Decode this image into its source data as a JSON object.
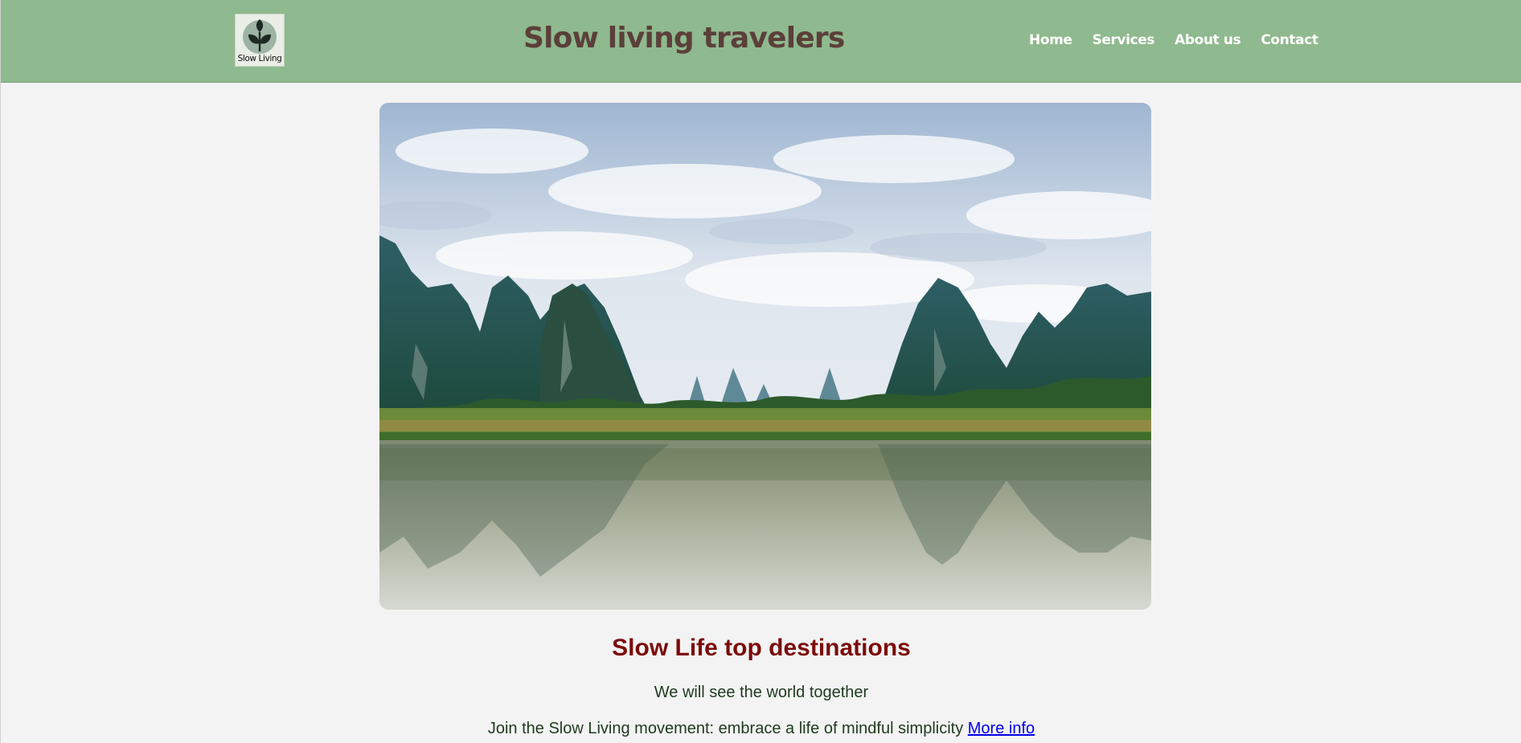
{
  "header": {
    "logo_text": "Slow Living",
    "title": "Slow living travelers",
    "nav": [
      {
        "label": "Home"
      },
      {
        "label": "Services"
      },
      {
        "label": "About us"
      },
      {
        "label": "Contact"
      }
    ]
  },
  "hero": {
    "image": "mountain-river-landscape"
  },
  "main": {
    "headline": "Slow Life top destinations",
    "subtitle": "We will see the world together",
    "tagline": "Join the Slow Living movement: embrace a life of mindful simplicity",
    "more_link": "More info"
  },
  "colors": {
    "header_bg": "#8fb98e",
    "title": "#5b3f3a",
    "headline": "#7c0b0b",
    "link": "#0000ee",
    "page_bg": "#f3f3f3"
  }
}
